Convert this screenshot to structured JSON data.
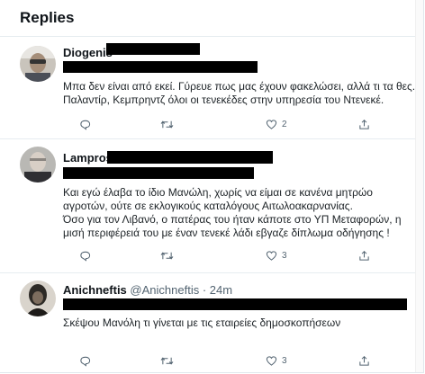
{
  "header": {
    "title": "Replies"
  },
  "tweets": [
    {
      "name": "Diogenis",
      "handle": "",
      "time": "",
      "lines": [
        "Μπα δεν είναι από εκεί. Γύρευε πως μας έχουν φακελώσει, αλλά τι τα θες..",
        "Παλαντίρ, Κεμπρηντζ όλοι οι τενεκέδες στην υπηρεσία του Ντενεκέ."
      ],
      "actions": {
        "reply": "",
        "retweet": "",
        "like": "2",
        "share": ""
      }
    },
    {
      "name": "Lampros",
      "handle": "",
      "time": "",
      "lines": [
        "Και εγώ έλαβα το ίδιο Μανώλη, χωρίς να είμαι σε κανένα μητρώο",
        "αγροτών, ούτε σε εκλογικούς καταλόγους Αιτωλοακαρνανίας.",
        "Όσο για τον Λιβανό, ο πατέρας του ήταν κάποτε στο ΥΠ Μεταφορών, η",
        "μισή περιφέρειά του με έναν τενεκέ λάδι εβγαζε δίπλωμα οδήγησης !"
      ],
      "actions": {
        "reply": "",
        "retweet": "",
        "like": "3",
        "share": ""
      }
    },
    {
      "name": "Anichneftis",
      "handle": "@Anichneftis",
      "time": "· 24m",
      "lines": [
        "Σκέψου Μανόλη τι γίνεται με τις εταιρείες δημοσκοπήσεων"
      ],
      "actions": {
        "reply": "",
        "retweet": "",
        "like": "3",
        "share": ""
      }
    }
  ],
  "colors": {
    "text": "#0f1419",
    "secondary": "#536471",
    "border": "#e6ecf0",
    "redaction": "#000000"
  },
  "icons": {
    "reply": "comment-icon",
    "retweet": "retweet-icon",
    "like": "heart-icon",
    "share": "share-icon"
  }
}
